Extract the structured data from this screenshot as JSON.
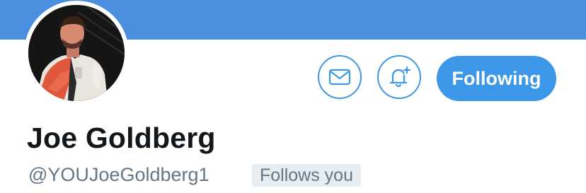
{
  "colors": {
    "banner": "#4a8fdf",
    "accent": "#3d97e8",
    "handle_text": "#657786",
    "badge_bg": "#e6ecf0",
    "name_text": "#14171a"
  },
  "profile": {
    "display_name": "Joe Goldberg",
    "handle": "@YOUJoeGoldberg1",
    "follows_you_badge": "Follows you",
    "avatar_alt": "profile-photo"
  },
  "actions": {
    "message_icon": "envelope-icon",
    "notify_icon": "bell-plus-icon",
    "follow_button_label": "Following"
  }
}
